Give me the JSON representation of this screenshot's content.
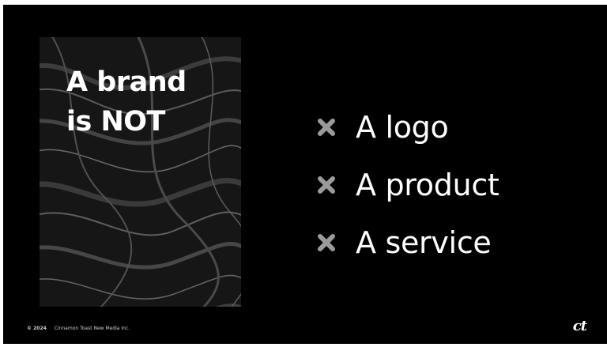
{
  "slide": {
    "background": "#000000",
    "heading_lines": [
      "A brand",
      "is NOT"
    ],
    "items": [
      {
        "icon": "x-icon",
        "label": "A logo"
      },
      {
        "icon": "x-icon",
        "label": "A product"
      },
      {
        "icon": "x-icon",
        "label": "A service"
      }
    ],
    "icon_color": "#9a9a9a",
    "footer": {
      "year": "© 2024",
      "company": "Cinnamon Toast New Media Inc."
    },
    "logo_text": "ct"
  }
}
